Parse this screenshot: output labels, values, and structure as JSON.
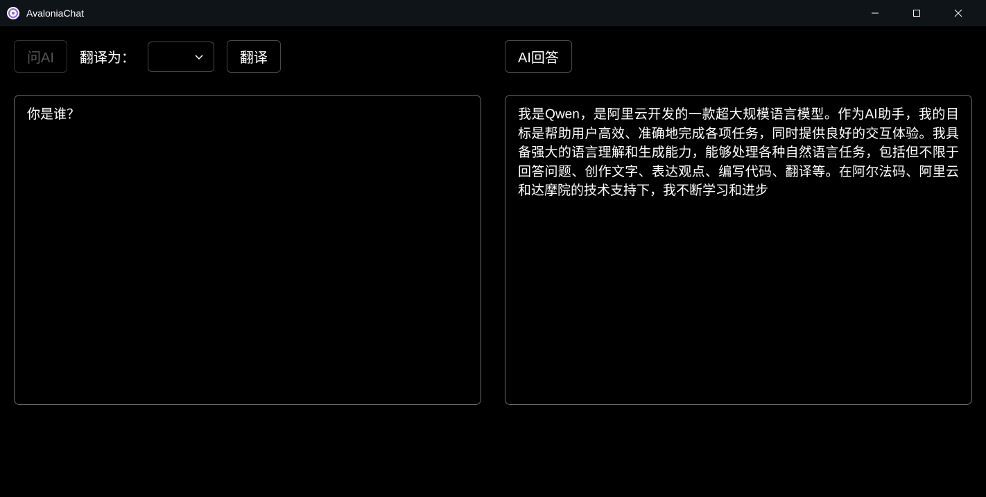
{
  "window": {
    "title": "AvaloniaChat"
  },
  "toolbar": {
    "ask_ai_label": "问AI",
    "translate_to_label": "翻译为：",
    "translate_button_label": "翻译",
    "ai_answer_label": "AI回答"
  },
  "input": {
    "value": "你是谁？"
  },
  "output": {
    "text": "我是Qwen，是阿里云开发的一款超大规模语言模型。作为AI助手，我的目标是帮助用户高效、准确地完成各项任务，同时提供良好的交互体验。我具备强大的语言理解和生成能力，能够处理各种自然语言任务，包括但不限于回答问题、创作文字、表达观点、编写代码、翻译等。在阿尔法码、阿里云和达摩院的技术支持下，我不断学习和进步"
  }
}
